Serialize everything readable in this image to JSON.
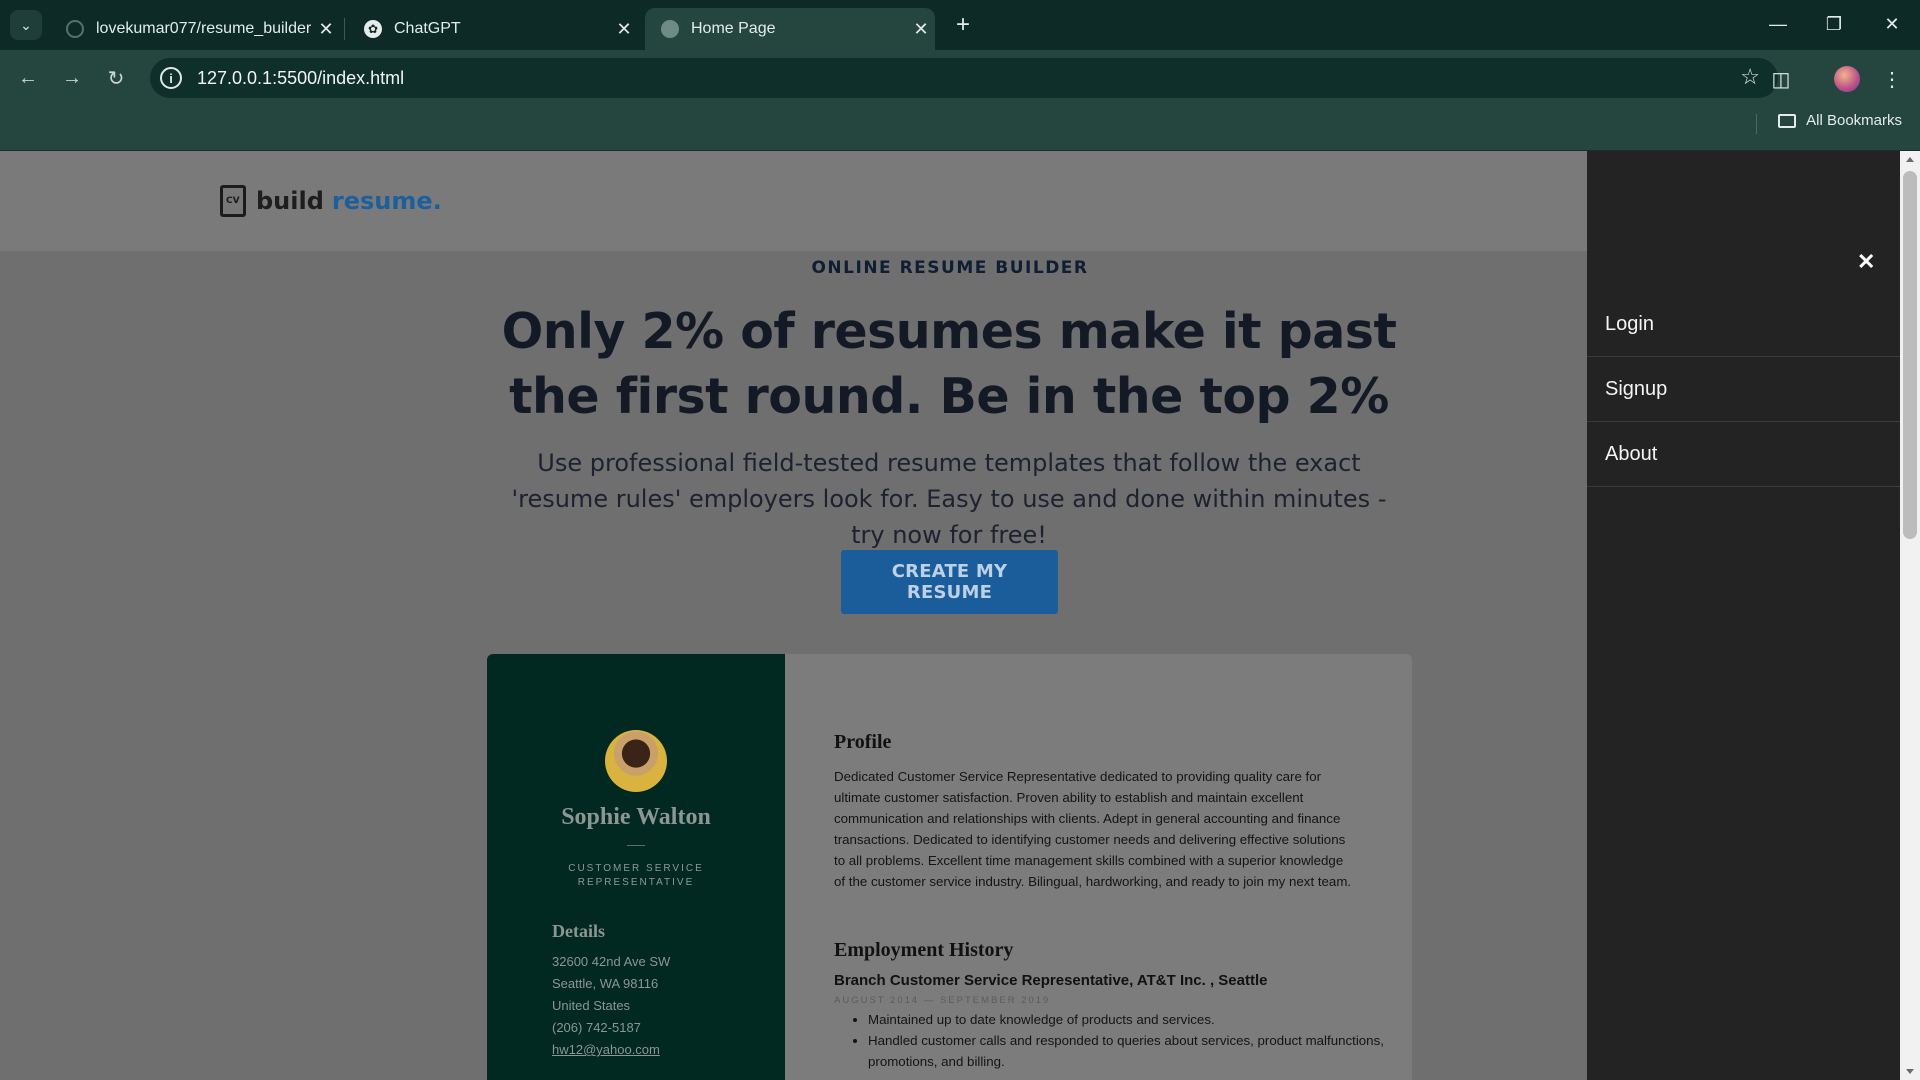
{
  "browser": {
    "tabs": [
      {
        "title": "lovekumar077/resume_builder",
        "icon": "github-icon"
      },
      {
        "title": "ChatGPT",
        "icon": "chatgpt-icon"
      },
      {
        "title": "Home Page",
        "icon": "globe-icon",
        "active": true
      }
    ],
    "url": "127.0.0.1:5500/index.html",
    "bookmarks_label": "All Bookmarks"
  },
  "site": {
    "logo_mark": "CV",
    "logo_build": "build",
    "logo_resume": "resume.",
    "eyebrow": "ONLINE RESUME BUILDER",
    "headline": "Only 2% of resumes make it past the first round. Be in the top 2%",
    "subheadline": "Use professional field-tested resume templates that follow the exact 'resume rules' employers look for. Easy to use and done within minutes - try now for free!",
    "cta_label": "CREATE MY RESUME",
    "brand_color": "#1b5c9a"
  },
  "resume": {
    "name": "Sophie Walton",
    "title": "CUSTOMER SERVICE REPRESENTATIVE",
    "details_heading": "Details",
    "details": [
      "32600 42nd Ave SW",
      "Seattle, WA 98116",
      "United States",
      "(206) 742-5187",
      "hw12@yahoo.com"
    ],
    "profile_heading": "Profile",
    "profile_text": "Dedicated Customer Service Representative dedicated to providing quality care for ultimate customer satisfaction. Proven ability to establish and maintain excellent communication and relationships with clients. Adept in general accounting and finance transactions. Dedicated to identifying customer needs and delivering effective solutions to all problems. Excellent time management skills combined with a superior knowledge of the customer service industry. Bilingual, hardworking, and ready to join my next team.",
    "employment_heading": "Employment History",
    "job_title": "Branch Customer Service Representative, AT&T Inc. , Seattle",
    "job_dates": "AUGUST 2014 — SEPTEMBER 2019",
    "job_bullets": [
      "Maintained up to date knowledge of products and services.",
      "Handled customer calls and responded to queries about services, product malfunctions, promotions, and billing."
    ],
    "sidebar_color": "#012821"
  },
  "drawer": {
    "items": [
      "Login",
      "Signup",
      "About"
    ]
  }
}
